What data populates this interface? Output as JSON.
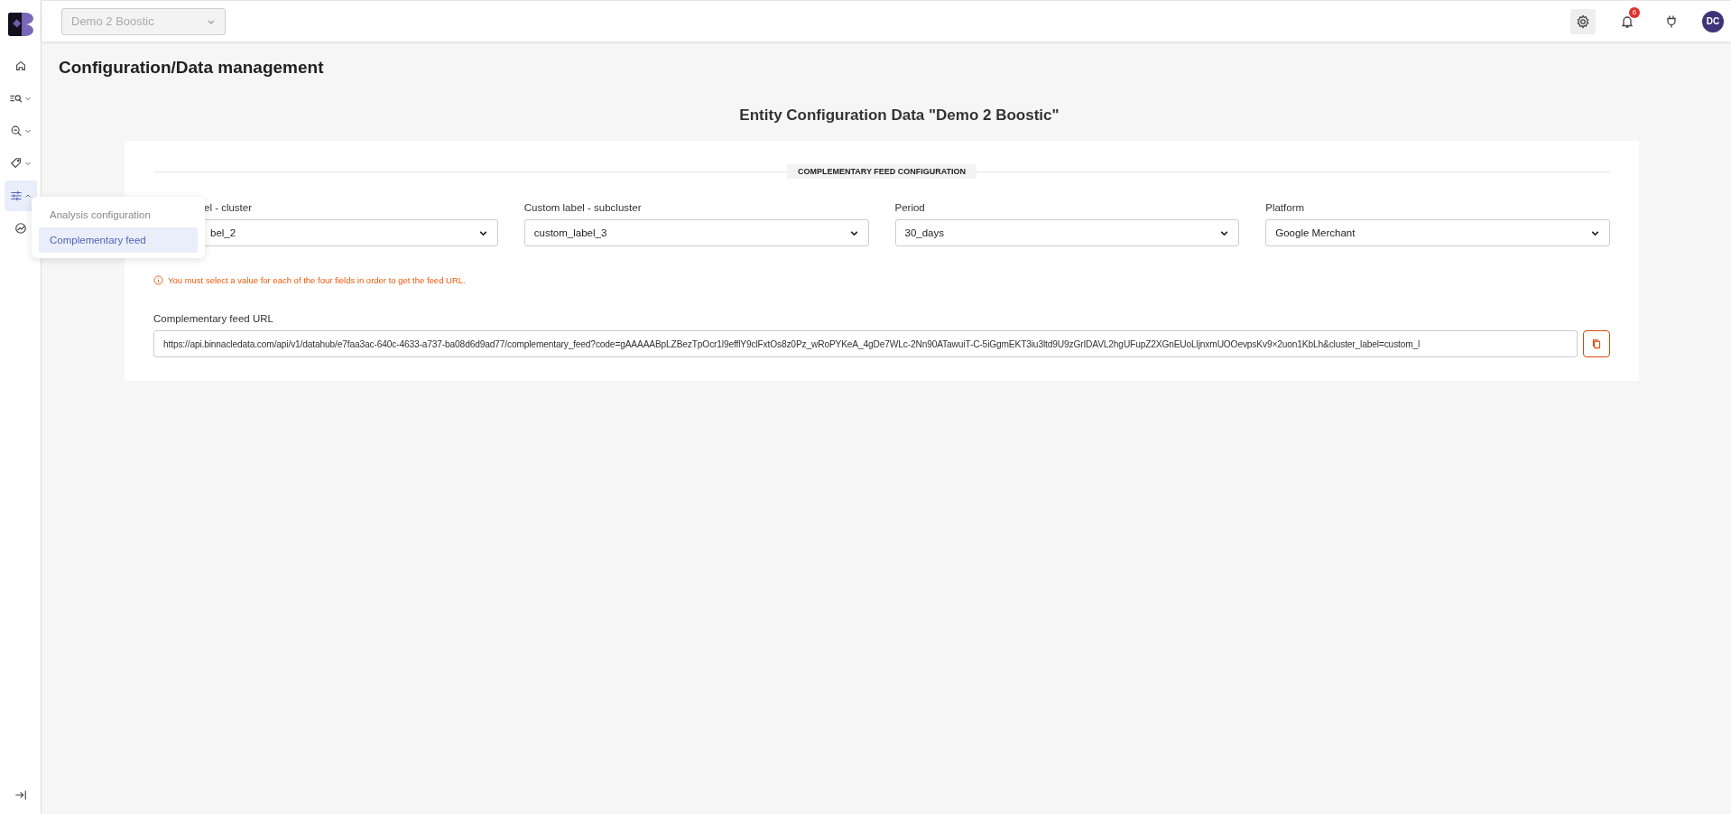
{
  "header": {
    "workspace_select": {
      "value": "Demo 2 Boostic",
      "disabled": true
    },
    "notifications_badge": "6",
    "avatar": "DC"
  },
  "sidebar": {
    "items": [
      {
        "kind": "home",
        "submenu": false,
        "expanded": false
      },
      {
        "kind": "list-search",
        "submenu": true,
        "expanded": false
      },
      {
        "kind": "search",
        "submenu": true,
        "expanded": false
      },
      {
        "kind": "tag",
        "submenu": true,
        "expanded": false
      },
      {
        "kind": "sliders",
        "submenu": true,
        "expanded": true
      },
      {
        "kind": "gauge",
        "submenu": false,
        "expanded": false
      }
    ]
  },
  "submenu": {
    "items": [
      {
        "label": "Analysis configuration",
        "selected": false
      },
      {
        "label": "Complementary feed",
        "selected": true
      }
    ]
  },
  "page": {
    "title": "Configuration/Data management",
    "entity_title": "Entity Configuration Data \"Demo 2 Boostic\"",
    "section_label": "COMPLEMENTARY FEED CONFIGURATION",
    "fields": [
      {
        "label": "el - cluster",
        "value": "bel_2",
        "covered": true
      },
      {
        "label": "Custom label - subcluster",
        "value": "custom_label_3",
        "covered": false
      },
      {
        "label": "Period",
        "value": "30_days",
        "covered": false
      },
      {
        "label": "Platform",
        "value": "Google Merchant",
        "covered": false
      }
    ],
    "warning": "You must select a value for each of the four fields in order to get the feed URL.",
    "url_label": "Complementary feed URL",
    "url_value": "https://api.binnacledata.com/api/v1/datahub/e7faa3ac-640c-4633-a737-ba08d6d9ad77/complementary_feed?code=gAAAAABpLZBezTpOcr1l9efflY9clFxtOs8z0Pz_wRoPYKeA_4gDe7WLc-2Nn90ATawuiT-C-5iGgmEKT3iu3ltd9U9zGrIDAVL2hgUFupZ2XGnEUoLljnxmUOOevpsKv9×2uon1KbLh&cluster_label=custom_l"
  }
}
